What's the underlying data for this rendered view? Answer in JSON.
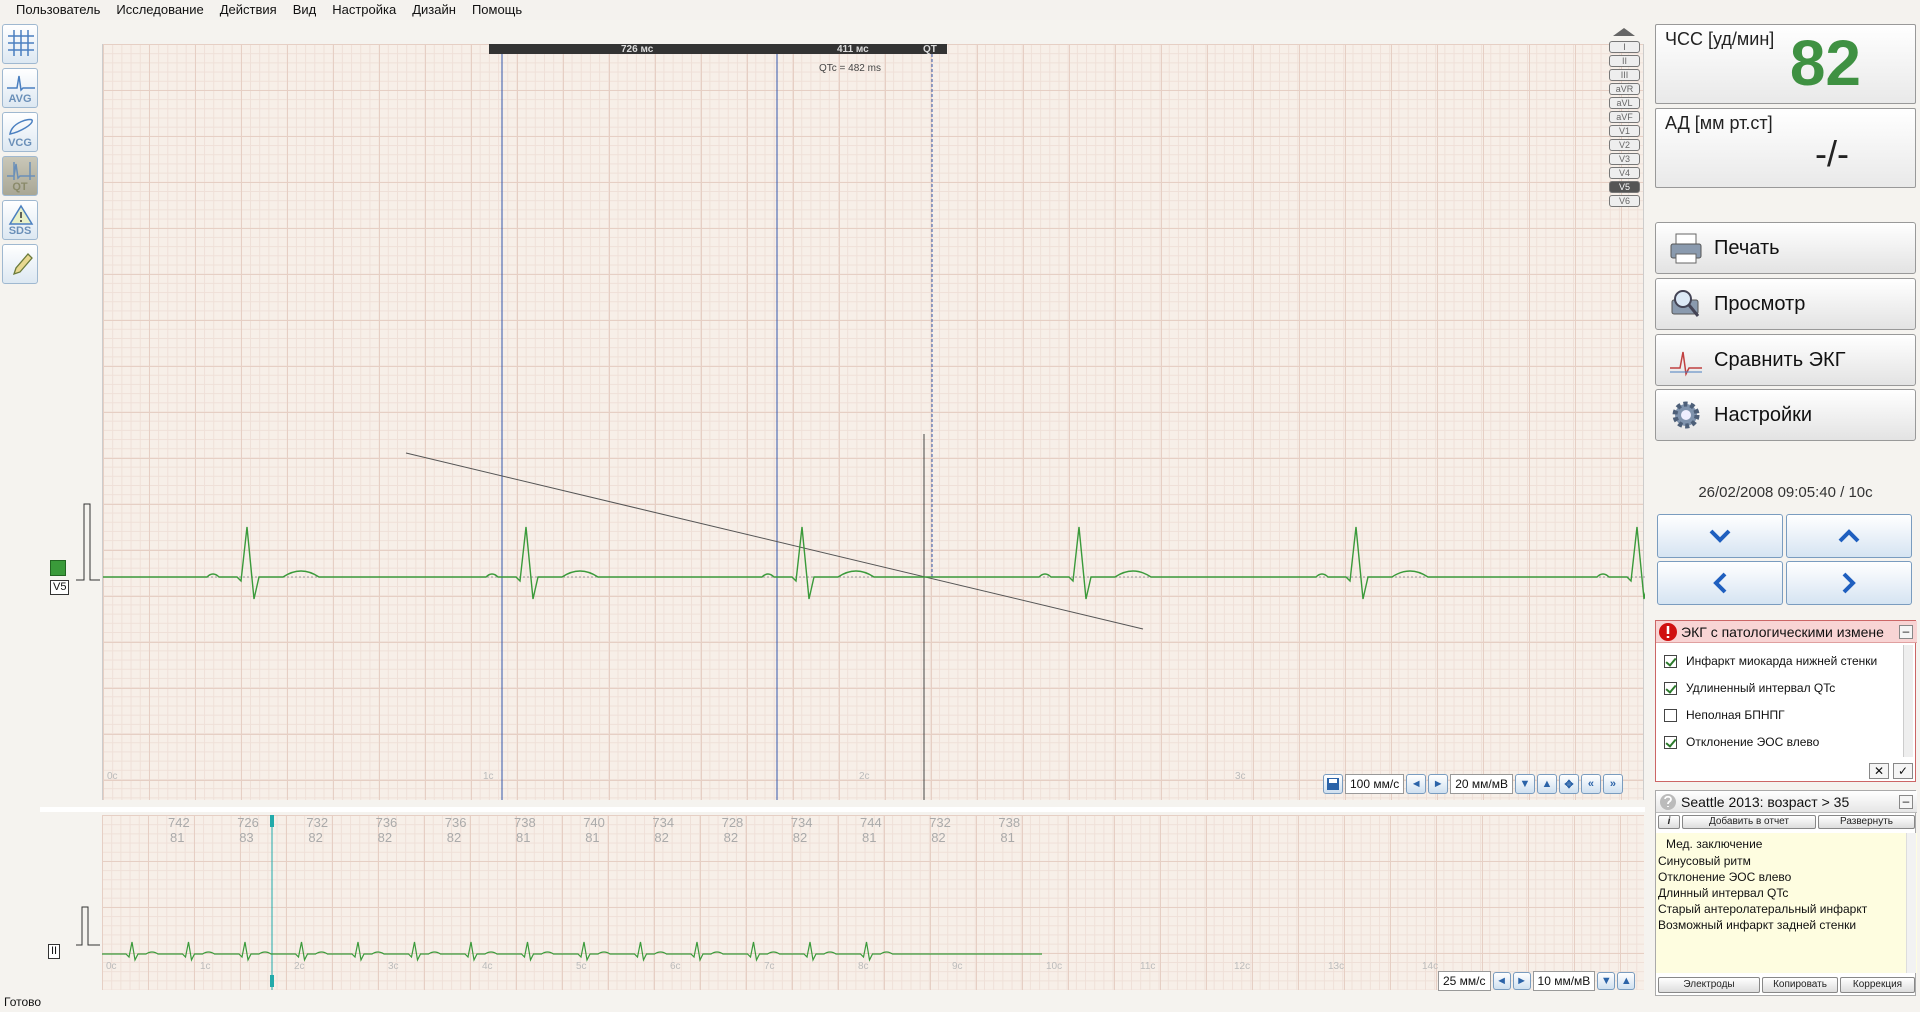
{
  "menu": [
    "Пользователь",
    "Исследование",
    "Действия",
    "Вид",
    "Настройка",
    "Дизайн",
    "Помощь"
  ],
  "tools": [
    {
      "label": "",
      "icon": "grid-icon"
    },
    {
      "label": "AVG",
      "icon": "avg-wave-icon"
    },
    {
      "label": "VCG",
      "icon": "vcg-loop-icon"
    },
    {
      "label": "QT",
      "icon": "qt-interval-icon"
    },
    {
      "label": "SDS",
      "icon": "sds-warning-icon"
    },
    {
      "label": "",
      "icon": "pencil-icon"
    }
  ],
  "ruler": {
    "interval1": "726 мс",
    "interval2": "411 мс",
    "qt_label": "QT",
    "qtc": "QTc = 482 ms"
  },
  "leads": [
    "I",
    "II",
    "III",
    "aVR",
    "aVL",
    "aVF",
    "V1",
    "V2",
    "V3",
    "V4",
    "V5",
    "V6"
  ],
  "selected_lead": "V5",
  "main_lead_label": "V5",
  "main_ticks": [
    "0c",
    "1c",
    "2c",
    "3c"
  ],
  "main_controls": {
    "speed": "100 мм/с",
    "gain": "20 мм/мВ"
  },
  "strip": {
    "lead_label": "II",
    "rr": [
      "742",
      "726",
      "732",
      "736",
      "736",
      "738",
      "740",
      "734",
      "728",
      "734",
      "744",
      "732",
      "738"
    ],
    "hr": [
      "81",
      "83",
      "82",
      "82",
      "82",
      "81",
      "81",
      "82",
      "82",
      "82",
      "81",
      "82",
      "81"
    ],
    "ticks": [
      "0c",
      "1c",
      "2c",
      "3c",
      "4c",
      "5c",
      "6c",
      "7c",
      "8c",
      "9c",
      "10c",
      "11c",
      "12c",
      "13c",
      "14c"
    ],
    "speed": "25 мм/с",
    "gain": "10 мм/мВ"
  },
  "vitals": {
    "hr_label": "ЧСС [уд/мин]",
    "hr_value": "82",
    "bp_label": "АД [мм рт.ст]",
    "bp_value": "-/-"
  },
  "actions": {
    "print": "Печать",
    "preview": "Просмотр",
    "compare": "Сравнить ЭКГ",
    "settings": "Настройки"
  },
  "datetime": "26/02/2008 09:05:40 / 10с",
  "findings": {
    "title": "ЭКГ с патологическими измене",
    "items": [
      {
        "text": "Инфаркт миокарда нижней стенки",
        "checked": true
      },
      {
        "text": "Удлиненный интервал QTc",
        "checked": true
      },
      {
        "text": "Неполная БПНПГ",
        "checked": false
      },
      {
        "text": "Отклонение ЭОС влево",
        "checked": true
      }
    ]
  },
  "seattle": {
    "title": "Seattle 2013: возраст > 35",
    "add_btn": "Добавить в отчет",
    "expand_btn": "Развернуть",
    "conclusion_header": "Мед. заключение",
    "conclusions": [
      "Синусовый ритм",
      "Отклонение ЭОС влево",
      "Длинный интервал QTc",
      "Старый антеролатеральный инфаркт",
      "Возможный инфаркт задней стенки"
    ],
    "bottom_buttons": [
      "Электроды",
      "Копировать",
      "Коррекция"
    ]
  },
  "status": "Готово",
  "colors": {
    "trace": "#3a9a3a",
    "accent": "#2b63a8",
    "hr": "#3f9142",
    "alert": "#d01010"
  }
}
